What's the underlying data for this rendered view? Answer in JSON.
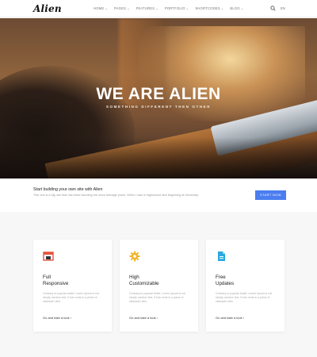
{
  "nav": {
    "logo": "Alien",
    "items": [
      {
        "label": "HOME"
      },
      {
        "label": "PAGES"
      },
      {
        "label": "FEATURES"
      },
      {
        "label": "PORTFOLIO"
      },
      {
        "label": "SHORTCODES"
      },
      {
        "label": "BLOG"
      }
    ],
    "caret": "⌄",
    "search_icon": "search-icon",
    "language": "EN"
  },
  "hero": {
    "title": "WE ARE ALIEN",
    "subtitle": "SOMETHING DIFFERENT THEN OTHER"
  },
  "cta": {
    "title": "Start building your own site with Alien",
    "text": "This one is a big one that has been haunting me since teenage years. When I was in highschool and beginning at University.",
    "button": "START NOW",
    "accent": "#4a7df0"
  },
  "cards": [
    {
      "icon": "browser-icon",
      "icon_color": "#e5533d",
      "title_line1": "Full",
      "title_line2": "Responsive",
      "desc": "Contrary to popular belief, Lorem Ipsum is not simply random text. It has roots in a piece of classical Latin.",
      "link": "Go and take a look ›"
    },
    {
      "icon": "gear-icon",
      "icon_color": "#f0b429",
      "title_line1": "High",
      "title_line2": "Customizable",
      "desc": "Contrary to popular belief, Lorem Ipsum is not simply random text. It has roots in a piece of classical Latin.",
      "link": "Go and take a look ›"
    },
    {
      "icon": "document-icon",
      "icon_color": "#29a9e0",
      "title_line1": "Free",
      "title_line2": "Updates",
      "desc": "Contrary to popular belief, Lorem Ipsum is not simply random text. It has roots in a piece of classical Latin.",
      "link": "Go and take a look ›"
    }
  ]
}
